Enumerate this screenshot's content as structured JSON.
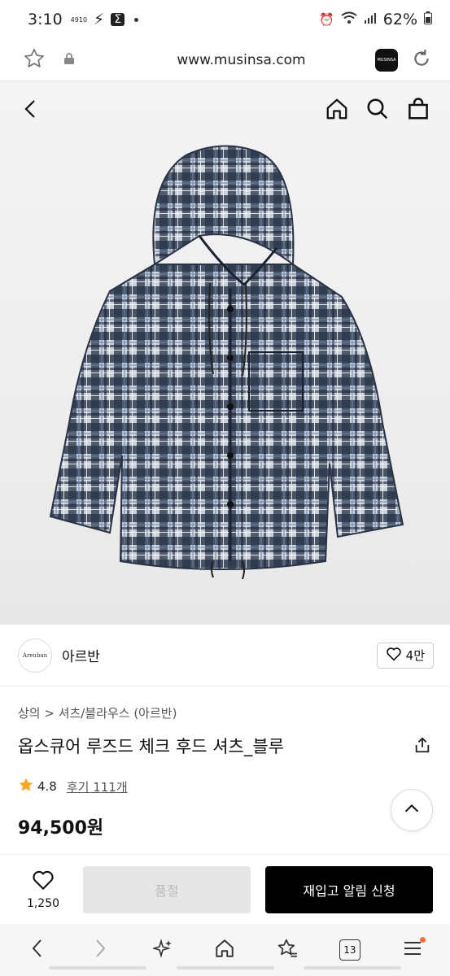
{
  "status": {
    "time": "3:10",
    "extra": "4910",
    "battery": "62%"
  },
  "browser": {
    "url": "www.musinsa.com",
    "app_badge": "MUSINSA",
    "tabs_count": "13"
  },
  "brand": {
    "logo_text": "Areuban",
    "name": "아르반",
    "likes": "4만"
  },
  "product": {
    "breadcrumb": "상의 > 셔츠/블라우스 (아르반)",
    "title": "옵스큐어 루즈드 체크 후드 셔츠_블루",
    "rating": "4.8",
    "reviews": "후기 111개",
    "price": "94,500원"
  },
  "actions": {
    "wish_count": "1,250",
    "soldout_label": "품절",
    "restock_label": "재입고 알림 신청"
  },
  "colors": {
    "accent": "#000000",
    "badge": "#ff6b2c",
    "star": "#f5a623"
  }
}
